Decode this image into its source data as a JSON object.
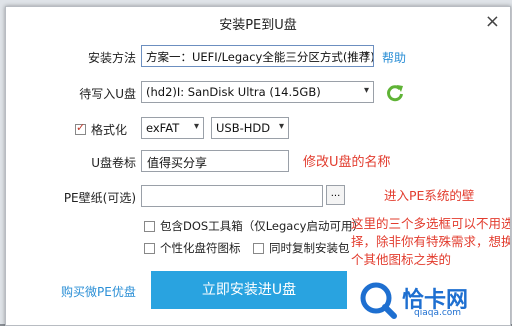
{
  "window": {
    "title": "安装PE到U盘",
    "close_label": "×"
  },
  "form": {
    "install_method_label": "安装方法",
    "install_method_value": "方案一：UEFI/Legacy全能三分区方式(推荐)",
    "help_label": "帮助",
    "target_disk_label": "待写入U盘",
    "target_disk_value": "(hd2)I: SanDisk Ultra (14.5GB)",
    "format_label": "格式化",
    "format_checked": true,
    "filesystem_value": "exFAT",
    "boot_mode_value": "USB-HDD",
    "volume_label_label": "U盘卷标",
    "volume_label_value": "值得买分享",
    "wallpaper_label": "PE壁纸(可选)",
    "wallpaper_value": "",
    "browse_label": "...",
    "opt_dos_label": "包含DOS工具箱（仅Legacy启动可用）",
    "opt_icon_label": "个性化盘符图标",
    "opt_copy_label": "同时复制安装包"
  },
  "footer": {
    "buy_link": "购买微PE优盘",
    "install_button": "立即安装进U盘"
  },
  "annotations": {
    "volume_note": "修改U盘的名称",
    "wallpaper_note": "进入PE系统的壁",
    "options_note": "这里的三个多选框可以不用选择，除非你有特殊需求，想换个其他图标之类的"
  },
  "watermark": {
    "brand": "恰卡网",
    "domain": "qiaqa.com"
  },
  "colors": {
    "accent": "#29a3e0",
    "note_red": "#e23c2e",
    "refresh_green": "#5fb336"
  }
}
